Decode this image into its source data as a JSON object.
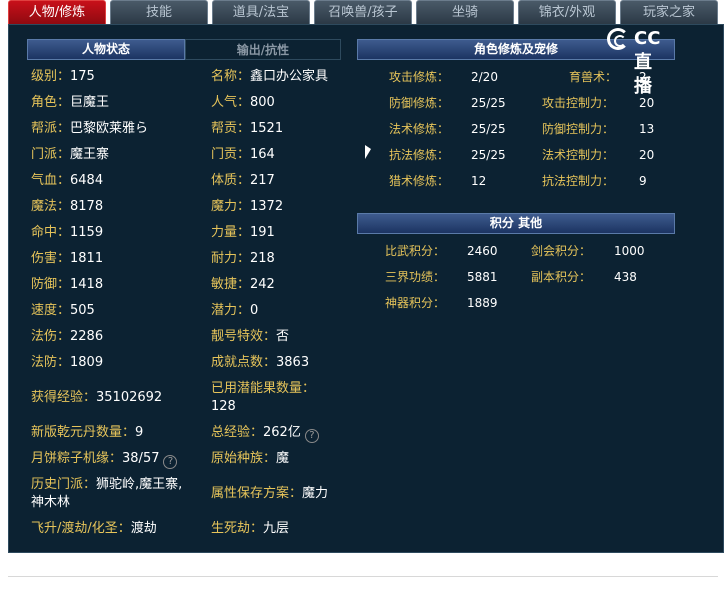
{
  "tabs": [
    {
      "label": "人物/修炼",
      "active": true
    },
    {
      "label": "技能",
      "active": false
    },
    {
      "label": "道具/法宝",
      "active": false
    },
    {
      "label": "召唤兽/孩子",
      "active": false
    },
    {
      "label": "坐骑",
      "active": false
    },
    {
      "label": "锦衣/外观",
      "active": false
    },
    {
      "label": "玩家之家",
      "active": false
    }
  ],
  "left_panel": {
    "header_active": "人物状态",
    "header_inactive": "输出/抗性",
    "col1": [
      {
        "label": "级别：",
        "value": "175"
      },
      {
        "label": "角色：",
        "value": "巨魔王"
      },
      {
        "label": "帮派：",
        "value": "巴黎欧莱雅ら"
      },
      {
        "label": "门派：",
        "value": "魔王寨"
      },
      {
        "label": "气血：",
        "value": "6484"
      },
      {
        "label": "魔法：",
        "value": "8178"
      },
      {
        "label": "命中：",
        "value": "1159"
      },
      {
        "label": "伤害：",
        "value": "1811"
      },
      {
        "label": "防御：",
        "value": "1418"
      },
      {
        "label": "速度：",
        "value": "505"
      },
      {
        "label": "法伤：",
        "value": "2286"
      },
      {
        "label": "法防：",
        "value": "1809"
      },
      {
        "label": "获得经验：",
        "value": "35102692"
      },
      {
        "label": "新版乾元丹数量：",
        "value": "9"
      },
      {
        "label": "月饼粽子机缘：",
        "value": "38/57"
      },
      {
        "label": "历史门派：",
        "value": "狮驼岭,魔王寨,",
        "value2": "神木林"
      },
      {
        "label": "飞升/渡劫/化圣：",
        "value": "渡劫"
      }
    ],
    "col2": [
      {
        "label": "名称：",
        "value": "鑫口办公家具"
      },
      {
        "label": "人气：",
        "value": "800"
      },
      {
        "label": "帮贡：",
        "value": "1521"
      },
      {
        "label": "门贡：",
        "value": "164"
      },
      {
        "label": "体质：",
        "value": "217"
      },
      {
        "label": "魔力：",
        "value": "1372"
      },
      {
        "label": "力量：",
        "value": "191"
      },
      {
        "label": "耐力：",
        "value": "218"
      },
      {
        "label": "敏捷：",
        "value": "242"
      },
      {
        "label": "潜力：",
        "value": "0"
      },
      {
        "label": "靓号特效：",
        "value": "否"
      },
      {
        "label": "成就点数：",
        "value": "3863"
      },
      {
        "label": "已用潜能果数量：",
        "value": "128"
      },
      {
        "label": "总经验：",
        "value": "262亿"
      },
      {
        "label": "原始种族：",
        "value": "魔"
      },
      {
        "label": "属性保存方案：",
        "value": "魔力"
      },
      {
        "label": "生死劫：",
        "value": "九层"
      }
    ]
  },
  "right_panel": {
    "header_cultivation": "角色修炼及宠修",
    "logo_text": "CC直播",
    "col3": [
      {
        "label": "攻击修炼：",
        "value": "2/20"
      },
      {
        "label": "防御修炼：",
        "value": "25/25"
      },
      {
        "label": "法术修炼：",
        "value": "25/25"
      },
      {
        "label": "抗法修炼：",
        "value": "25/25"
      },
      {
        "label": "猎术修炼：",
        "value": "12"
      }
    ],
    "col4": [
      {
        "label": "育兽术：",
        "value": "2"
      },
      {
        "label": "攻击控制力：",
        "value": "20"
      },
      {
        "label": "防御控制力：",
        "value": "13"
      },
      {
        "label": "法术控制力：",
        "value": "20"
      },
      {
        "label": "抗法控制力：",
        "value": "9"
      }
    ],
    "header_points": "积分 其他",
    "points_col1": [
      {
        "label": "比武积分：",
        "value": "2460"
      },
      {
        "label": "三界功绩：",
        "value": "5881"
      },
      {
        "label": "神器积分：",
        "value": "1889"
      }
    ],
    "points_col2": [
      {
        "label": "剑会积分：",
        "value": "1000"
      },
      {
        "label": "副本积分：",
        "value": "438"
      }
    ]
  },
  "help_symbol": "?"
}
